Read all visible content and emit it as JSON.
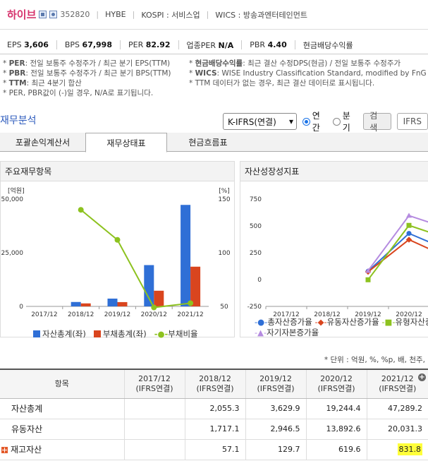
{
  "header": {
    "company": "하이브",
    "code": "352820",
    "ticker": "HYBE",
    "market": "KOSPI : 서비스업",
    "wics": "WICS : 방송과엔터테인먼트"
  },
  "metrics": [
    {
      "label": "EPS",
      "value": "3,606"
    },
    {
      "label": "BPS",
      "value": "67,998"
    },
    {
      "label": "PER",
      "value": "82.92"
    },
    {
      "label": "업종PER",
      "value": "N/A"
    },
    {
      "label": "PBR",
      "value": "4.40"
    },
    {
      "label": "현금배당수익률",
      "value": ""
    }
  ],
  "notes": {
    "left": [
      {
        "key": "PER",
        "text": ": 전일 보통주 수정주가 / 최근 분기 EPS(TTM)"
      },
      {
        "key": "PBR",
        "text": ": 전일 보통주 수정주가 / 최근 분기 BPS(TTM)"
      },
      {
        "key": "TTM",
        "text": ": 최근 4분기 합산"
      },
      {
        "key": "",
        "text": "PER, PBR값이 (-)일 경우, N/A로 표기됩니다."
      }
    ],
    "right": [
      {
        "key": "현금배당수익률",
        "text": ": 최근 결산 수정DPS(현금) / 전일 보통주 수정주가"
      },
      {
        "key": "WICS",
        "text": ": WISE Industry Classification Standard, modified by FnG"
      },
      {
        "key": "",
        "text": "TTM 데이터가 없는 경우, 최근 결산 데이터로 표시됩니다."
      }
    ]
  },
  "section": {
    "title": "재무분석",
    "select_value": "K-IFRS(연결)",
    "radio_annual": "연간",
    "radio_quarter": "분기",
    "search_button": "검색",
    "ifrs_button": "IFRS"
  },
  "tabs": [
    "포괄손익계산서",
    "재무상태표",
    "현금흐름표"
  ],
  "panels": {
    "left_title": "주요재무항목",
    "right_title": "자산성장성지표"
  },
  "chart_data": [
    {
      "type": "bar",
      "title": "주요재무항목",
      "categories": [
        "2017/12",
        "2018/12",
        "2019/12",
        "2020/12",
        "2021/12"
      ],
      "y_unit_left": "[억원]",
      "y_unit_right": "[%]",
      "left_ticks": [
        "50,000",
        "25,000",
        "0"
      ],
      "right_ticks": [
        "150",
        "100",
        "50"
      ],
      "ylim": [
        0,
        50000
      ],
      "ylim_right": [
        50,
        150
      ],
      "series": [
        {
          "name": "자산총계(좌)",
          "kind": "bar",
          "color": "#2f6fd6",
          "values": [
            null,
            2055.3,
            3629.9,
            19244.4,
            47289.2
          ]
        },
        {
          "name": "부채총계(좌)",
          "kind": "bar",
          "color": "#d9451e",
          "values": [
            null,
            1400,
            2000,
            7300,
            18500
          ]
        },
        {
          "name": "부채비율",
          "kind": "line",
          "axis": "right",
          "color": "#8dc21f",
          "values": [
            null,
            140,
            112,
            49,
            53
          ]
        }
      ]
    },
    {
      "type": "line",
      "title": "자산성장성지표",
      "categories": [
        "2017/12",
        "2018/12",
        "2019/12",
        "2020/12"
      ],
      "y_ticks": [
        "750",
        "500",
        "250",
        "0",
        "-250"
      ],
      "ylim": [
        -250,
        750
      ],
      "series": [
        {
          "name": "총자산증가율",
          "color": "#2f6fd6",
          "values": [
            null,
            null,
            77,
            430
          ]
        },
        {
          "name": "유동자산증가율",
          "color": "#d9451e",
          "values": [
            null,
            null,
            72,
            372
          ]
        },
        {
          "name": "유형자산증가율",
          "color": "#8dc21f",
          "values": [
            null,
            null,
            -2,
            505
          ]
        },
        {
          "name": "자기자본증가율",
          "color": "#b58be0",
          "values": [
            null,
            null,
            82,
            596
          ]
        }
      ]
    }
  ],
  "units_text": "* 단위 : 억원, %, %p, 배, 천주,",
  "table": {
    "headers": [
      {
        "l1": "항목",
        "l2": ""
      },
      {
        "l1": "2017/12",
        "l2": "(IFRS연결)"
      },
      {
        "l1": "2018/12",
        "l2": "(IFRS연결)"
      },
      {
        "l1": "2019/12",
        "l2": "(IFRS연결)"
      },
      {
        "l1": "2020/12",
        "l2": "(IFRS연결)"
      },
      {
        "l1": "2021/12",
        "l2": "(IFRS연결)"
      }
    ],
    "rows": [
      {
        "label": "자산총계",
        "cells": [
          "",
          "2,055.3",
          "3,629.9",
          "19,244.4",
          "47,289.2"
        ]
      },
      {
        "label": "유동자산",
        "cells": [
          "",
          "1,717.1",
          "2,946.5",
          "13,892.6",
          "20,031.3"
        ]
      },
      {
        "label": "재고자산",
        "cells": [
          "",
          "57.1",
          "129.7",
          "619.6",
          "831.8"
        ]
      }
    ]
  }
}
